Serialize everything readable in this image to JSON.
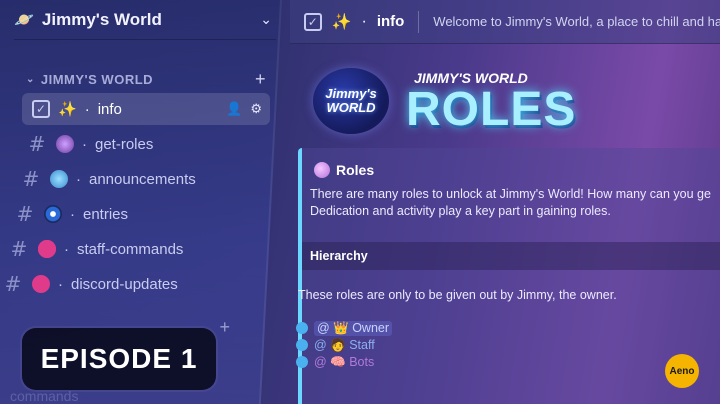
{
  "server": {
    "name": "Jimmy's World",
    "category": "JIMMY'S WORLD",
    "channels": [
      {
        "name": "info",
        "hash": "#"
      },
      {
        "name": "get-roles",
        "hash": "#"
      },
      {
        "name": "announcements",
        "hash": "#"
      },
      {
        "name": "entries",
        "hash": "#"
      },
      {
        "name": "staff-commands",
        "hash": "#"
      },
      {
        "name": "discord-updates",
        "hash": "#"
      }
    ],
    "faded_channel": "commands"
  },
  "topbar": {
    "channel_name": "info",
    "topic": "Welcome to Jimmy's World, a place to chill and han"
  },
  "banner": {
    "logo_line1": "Jimmy's",
    "logo_line2": "WORLD",
    "small_title": "JIMMY'S WORLD",
    "big_title": "ROLES"
  },
  "embed": {
    "title": "Roles",
    "desc_line1": "There are many roles to unlock at Jimmy's World! How many can you ge",
    "desc_line2": "Dedication and activity play a key part in gaining roles.",
    "hierarchy_label": "Hierarchy",
    "note": "These roles are only to be given out by Jimmy, the owner.",
    "roles": [
      {
        "name": "Owner",
        "color": "#c8d4ff"
      },
      {
        "name": "Staff",
        "color": "#8ab0f0"
      },
      {
        "name": "Bots",
        "color": "#b07ad8"
      }
    ]
  },
  "episode": "EPISODE 1",
  "aeno_logo": "Aeno",
  "colors": {
    "accent": "#6ad8ff",
    "sidebar": "#373c8c"
  }
}
